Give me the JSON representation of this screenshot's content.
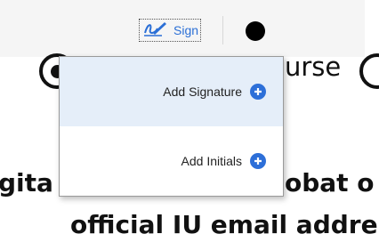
{
  "toolbar": {
    "sign_button": {
      "label": "Sign",
      "icon": "signature-pen-icon"
    },
    "ink_color": "#000000"
  },
  "document": {
    "line1_fragment": "urse",
    "line3_left_fragment": "gita",
    "line3_right_fragment": "obat o",
    "line4": "official IU email addre"
  },
  "sign_menu": {
    "items": [
      {
        "label": "Add Signature",
        "icon": "plus-circle-icon"
      },
      {
        "label": "Add Initials",
        "icon": "plus-circle-icon"
      }
    ],
    "accent_color": "#2d6fd8",
    "hover_background": "#e5eef9"
  }
}
